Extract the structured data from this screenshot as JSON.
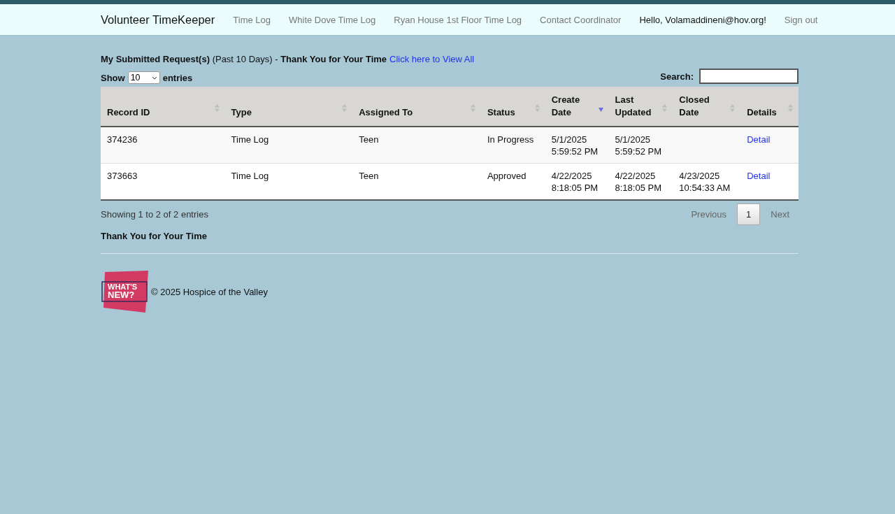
{
  "navbar": {
    "brand": "Volunteer TimeKeeper",
    "links": [
      {
        "label": "Time Log"
      },
      {
        "label": "White Dove Time Log"
      },
      {
        "label": "Ryan House 1st Floor Time Log"
      },
      {
        "label": "Contact Coordinator"
      }
    ],
    "greeting": "Hello, Volamaddineni@hov.org!",
    "sign_out": "Sign out"
  },
  "heading": {
    "text": "**My Submitted Request(s)** (Past 10 Days) - **Thank You for Your Time**",
    "link": "Click here to View All"
  },
  "length": {
    "before": "Show",
    "value": "10",
    "after": "entries"
  },
  "search": {
    "label": "Search:"
  },
  "table": {
    "columns": [
      {
        "label": "Record ID",
        "sorted": false
      },
      {
        "label": "Type",
        "sorted": false
      },
      {
        "label": "Assigned To",
        "sorted": false
      },
      {
        "label": "Status",
        "sorted": false
      },
      {
        "label": "Create Date",
        "sorted": true
      },
      {
        "label": "Last Updated",
        "sorted": false
      },
      {
        "label": "Closed Date",
        "sorted": false
      },
      {
        "label": "Details",
        "sorted": false
      }
    ],
    "rows": [
      {
        "cells": [
          "374236",
          "Time Log",
          "Teen",
          "In Progress",
          "5/1/2025 5:59:52 PM",
          "5/1/2025 5:59:52 PM",
          ""
        ],
        "link": "Detail"
      },
      {
        "cells": [
          "373663",
          "Time Log",
          "Teen",
          "Approved",
          "4/22/2025 8:18:05 PM",
          "4/22/2025 8:18:05 PM",
          "4/23/2025 10:54:33 AM"
        ],
        "link": "Detail"
      }
    ]
  },
  "info": "Showing 1 to 2 of 2 entries",
  "pagination": [
    {
      "label": "Previous",
      "disabled": true,
      "selected": false
    },
    {
      "label": "1",
      "disabled": false,
      "selected": true
    },
    {
      "label": "Next",
      "disabled": true,
      "selected": false
    }
  ],
  "thanks": "Thank You for Your Time",
  "footer": {
    "logo": [
      "WHAT'S",
      "NEW?"
    ],
    "copyright": "© 2025 Hospice of the Valley"
  }
}
